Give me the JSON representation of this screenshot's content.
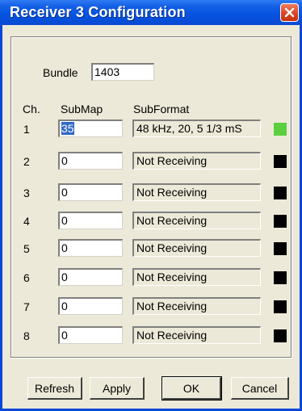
{
  "window": {
    "title": "Receiver 3 Configuration"
  },
  "bundle": {
    "label": "Bundle",
    "value": "1403"
  },
  "columns": {
    "ch": "Ch.",
    "submap": "SubMap",
    "subformat": "SubFormat"
  },
  "channels": [
    {
      "ch": "1",
      "submap": "35",
      "subformat": "48 kHz, 20, 5 1/3 mS",
      "status_color": "#5ccf3e"
    },
    {
      "ch": "2",
      "submap": "0",
      "subformat": "Not Receiving",
      "status_color": "#000000"
    },
    {
      "ch": "3",
      "submap": "0",
      "subformat": "Not Receiving",
      "status_color": "#000000"
    },
    {
      "ch": "4",
      "submap": "0",
      "subformat": "Not Receiving",
      "status_color": "#000000"
    },
    {
      "ch": "5",
      "submap": "0",
      "subformat": "Not Receiving",
      "status_color": "#000000"
    },
    {
      "ch": "6",
      "submap": "0",
      "subformat": "Not Receiving",
      "status_color": "#000000"
    },
    {
      "ch": "7",
      "submap": "0",
      "subformat": "Not Receiving",
      "status_color": "#000000"
    },
    {
      "ch": "8",
      "submap": "0",
      "subformat": "Not Receiving",
      "status_color": "#000000"
    }
  ],
  "buttons": {
    "refresh": "Refresh",
    "apply": "Apply",
    "ok": "OK",
    "cancel": "Cancel"
  },
  "colors": {
    "titlebar": "#0553df",
    "dialog_bg": "#ece9d8",
    "selection": "#316ac5"
  }
}
